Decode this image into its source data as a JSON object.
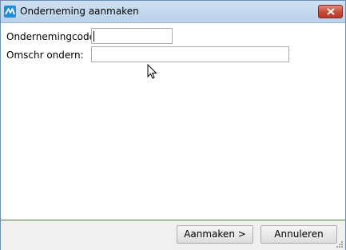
{
  "window": {
    "title": "Onderneming aanmaken"
  },
  "form": {
    "code_label": "Ondernemingcode:",
    "code_value": "",
    "description_label": "Omschr ondern:",
    "description_value": ""
  },
  "buttons": {
    "create_label": "Aanmaken >",
    "cancel_label": "Annuleren"
  },
  "colors": {
    "titlebar": "#c4d8ee",
    "close_button": "#c74a38",
    "footer": "#f0f0f0",
    "footer_border": "#4f7a3c"
  },
  "icons": [
    "app-logo-icon",
    "close-icon",
    "mouse-pointer-icon",
    "resize-grip-icon"
  ]
}
